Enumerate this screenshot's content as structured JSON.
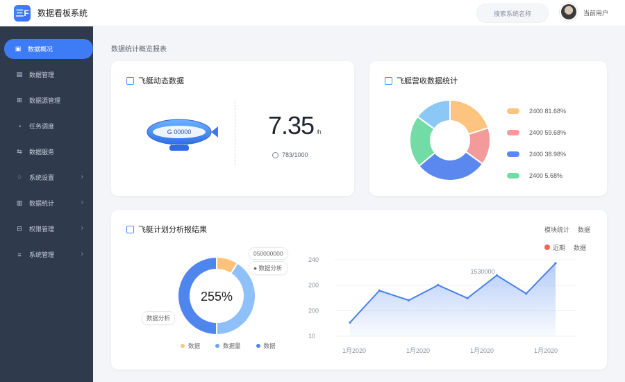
{
  "app": {
    "logo_text": "三F",
    "title": "数据看板系统"
  },
  "header": {
    "search_text": "搜索系统名称",
    "user_name": "当前用户"
  },
  "sidebar": {
    "items": [
      {
        "label": "数据概况",
        "icon": "dashboard-icon",
        "active": true,
        "has_arrow": false
      },
      {
        "label": "数据管理",
        "icon": "layers-icon",
        "active": false,
        "has_arrow": false
      },
      {
        "label": "数据源管理",
        "icon": "database-icon",
        "active": false,
        "has_arrow": false
      },
      {
        "label": "任务调度",
        "icon": "clock-icon",
        "active": false,
        "has_arrow": false
      },
      {
        "label": "数据服务",
        "icon": "link-icon",
        "active": false,
        "has_arrow": false
      },
      {
        "label": "系统设置",
        "icon": "bell-icon",
        "active": false,
        "has_arrow": true
      },
      {
        "label": "数据统计",
        "icon": "chart-icon",
        "active": false,
        "has_arrow": true
      },
      {
        "label": "权限管理",
        "icon": "grid-icon",
        "active": false,
        "has_arrow": true
      },
      {
        "label": "系统管理",
        "icon": "menu-icon",
        "active": false,
        "has_arrow": true
      }
    ]
  },
  "breadcrumb": "数据统计概览报表",
  "card1": {
    "title": "飞艇动态数据",
    "blimp_label": "G 00000",
    "big_value": "7.35",
    "big_unit": "/h",
    "sub_stat": "783/1000"
  },
  "card2": {
    "title": "飞艇营收数据统计",
    "legend": [
      {
        "label": "2400  81.68%",
        "color": "#fcc47e"
      },
      {
        "label": "2400  59.68%",
        "color": "#f39a9a"
      },
      {
        "label": "2400  38.98%",
        "color": "#5b88ee"
      },
      {
        "label": "2400  5.68%",
        "color": "#73dba6"
      }
    ],
    "chart_data": {
      "type": "pie",
      "slices": [
        {
          "color": "#fcc47e",
          "value": 20
        },
        {
          "color": "#f39a9a",
          "value": 15
        },
        {
          "color": "#5b88ee",
          "value": 29
        },
        {
          "color": "#73dba6",
          "value": 21
        },
        {
          "color": "#8cc8f5",
          "value": 15
        }
      ]
    }
  },
  "card3": {
    "title": "飞艇计划分析报结果",
    "controls_row1": [
      "模块统计",
      "数据"
    ],
    "controls_row2": [
      "近期",
      "数据"
    ],
    "callout_a": "050000000",
    "callout_b": "● 数据分析",
    "callout_c": "数据分析",
    "donut_center": "255%",
    "donut_legend": [
      {
        "label": "数据",
        "color": "#f7c77d"
      },
      {
        "label": "数据量",
        "color": "#6aa6f2"
      },
      {
        "label": "数据",
        "color": "#4f86ee"
      }
    ],
    "donut_data": {
      "type": "pie",
      "slices": [
        {
          "color": "#fcc27a",
          "value": 9
        },
        {
          "color": "#8ec0fa",
          "value": 41
        },
        {
          "color": "#4f86ee",
          "value": 50
        }
      ]
    },
    "line_annotation": "1530000",
    "chart_data": {
      "type": "area",
      "x": [
        "1月2020",
        "1月2020a",
        "1月2020b",
        "1月2020c"
      ],
      "x_ticks": [
        "1月2020",
        "1月2020",
        "1月2020",
        "1月2020"
      ],
      "y_ticks": [
        "240",
        "200",
        "200",
        "10"
      ],
      "ylim": [
        0,
        240
      ],
      "values": [
        45,
        150,
        118,
        168,
        125,
        200,
        140,
        240
      ]
    }
  }
}
